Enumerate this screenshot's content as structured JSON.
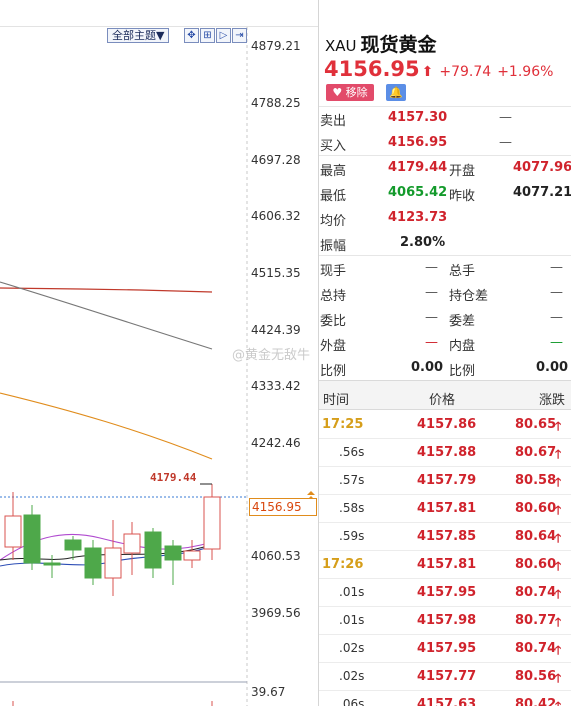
{
  "chart": {
    "toolbar": {
      "topic_select": "全部主题▼",
      "buttons": [
        "✥",
        "⊞",
        "▷",
        "⇥"
      ]
    },
    "y_axis_labels": [
      "4879.21",
      "4788.25",
      "4697.28",
      "4606.32",
      "4515.35",
      "4424.39",
      "4333.42",
      "4242.46",
      "4060.53",
      "3969.56",
      "39.67"
    ],
    "current_price_tag": "4156.95",
    "high_label": "4179.44",
    "watermark": "@黄金无敌牛",
    "colors": {
      "up": "#d9534f",
      "down": "#4ea84a",
      "ma_red": "#c0392b",
      "ma_gray": "#777777",
      "ma_orange": "#e08c1c",
      "ma_purple": "#b04ad0",
      "ma_blue": "#2c4db5"
    }
  },
  "panel": {
    "symbol": "XAU",
    "name": "现货黄金",
    "price": "4156.95",
    "price_arrow": "⬆",
    "change": "+79.74",
    "change_pct": "+1.96%",
    "remove_label": "♥ 移除",
    "bell_icon": "🔔",
    "sell": {
      "label": "卖出",
      "value": "4157.30",
      "extra": "—"
    },
    "buy": {
      "label": "买入",
      "value": "4156.95",
      "extra": "—"
    },
    "high": {
      "label": "最高",
      "value": "4179.44"
    },
    "open": {
      "label": "开盘",
      "value": "4077.96"
    },
    "low": {
      "label": "最低",
      "value": "4065.42"
    },
    "prev_close": {
      "label": "昨收",
      "value": "4077.21"
    },
    "avg": {
      "label": "均价",
      "value": "4123.73"
    },
    "amplitude": {
      "label": "振幅",
      "value": "2.80%"
    },
    "stats": [
      {
        "l1": "现手",
        "v1": "—",
        "l2": "总手",
        "v2": "—"
      },
      {
        "l1": "总持",
        "v1": "—",
        "l2": "持仓差",
        "v2": "—"
      },
      {
        "l1": "委比",
        "v1": "—",
        "l2": "委差",
        "v2": "—"
      },
      {
        "l1": "外盘",
        "v1": "—",
        "l2": "内盘",
        "v2": "—"
      },
      {
        "l1": "比例",
        "v1": "0.00",
        "l2": "比例",
        "v2": "0.00"
      }
    ],
    "tick_header": {
      "time": "时间",
      "price": "价格",
      "change": "涨跌"
    },
    "ticks": [
      {
        "time": "17:25",
        "price": "4157.86",
        "change": "80.65",
        "arrow": "🡑"
      },
      {
        "time": ".56s",
        "price": "4157.88",
        "change": "80.67",
        "arrow": "🡑"
      },
      {
        "time": ".57s",
        "price": "4157.79",
        "change": "80.58",
        "arrow": "🡑"
      },
      {
        "time": ".58s",
        "price": "4157.81",
        "change": "80.60",
        "arrow": "🡑"
      },
      {
        "time": ".59s",
        "price": "4157.85",
        "change": "80.64",
        "arrow": "🡑"
      },
      {
        "time": "17:26",
        "price": "4157.81",
        "change": "80.60",
        "arrow": "🡑"
      },
      {
        "time": ".01s",
        "price": "4157.95",
        "change": "80.74",
        "arrow": "🡑"
      },
      {
        "time": ".01s",
        "price": "4157.98",
        "change": "80.77",
        "arrow": "🡑"
      },
      {
        "time": ".02s",
        "price": "4157.95",
        "change": "80.74",
        "arrow": "🡑"
      },
      {
        "time": ".02s",
        "price": "4157.77",
        "change": "80.56",
        "arrow": "🡑"
      },
      {
        "time": ".06s",
        "price": "4157.63",
        "change": "80.42",
        "arrow": "🡑"
      }
    ]
  }
}
